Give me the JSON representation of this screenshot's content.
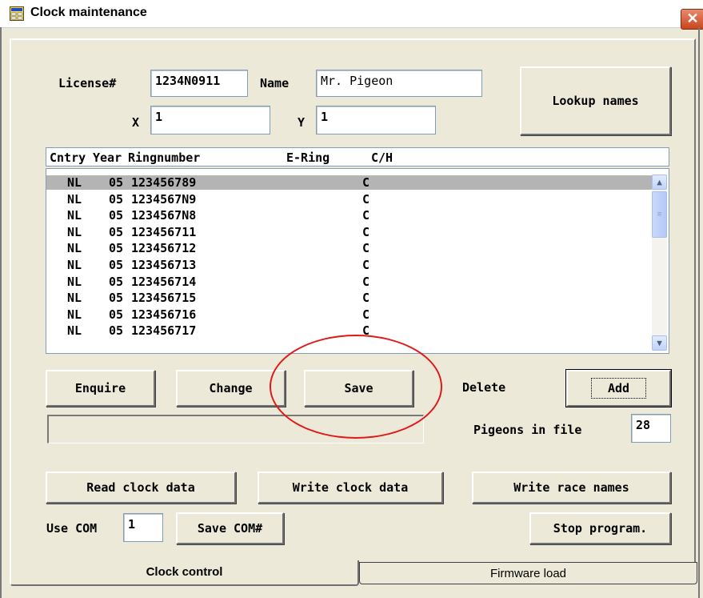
{
  "window": {
    "title": "Clock maintenance",
    "close_glyph": "✕"
  },
  "owner": {
    "license_label": "License#",
    "license_value": "1234N0911",
    "name_label": "Name",
    "name_value": "Mr. Pigeon",
    "x_label": "X",
    "x_value": "1",
    "y_label": "Y",
    "y_value": "1",
    "lookup_label": "Lookup names"
  },
  "list": {
    "columns": [
      "Cntry",
      "Year",
      "Ringnumber",
      "E-Ring",
      "C/H"
    ],
    "rows": [
      {
        "cntry": "NL",
        "year": "05",
        "ring": "123456789",
        "ering": "",
        "ch": "C"
      },
      {
        "cntry": "NL",
        "year": "05",
        "ring": "1234567N9",
        "ering": "",
        "ch": "C"
      },
      {
        "cntry": "NL",
        "year": "05",
        "ring": "1234567N8",
        "ering": "",
        "ch": "C"
      },
      {
        "cntry": "NL",
        "year": "05",
        "ring": "123456711",
        "ering": "",
        "ch": "C"
      },
      {
        "cntry": "NL",
        "year": "05",
        "ring": "123456712",
        "ering": "",
        "ch": "C"
      },
      {
        "cntry": "NL",
        "year": "05",
        "ring": "123456713",
        "ering": "",
        "ch": "C"
      },
      {
        "cntry": "NL",
        "year": "05",
        "ring": "123456714",
        "ering": "",
        "ch": "C"
      },
      {
        "cntry": "NL",
        "year": "05",
        "ring": "123456715",
        "ering": "",
        "ch": "C"
      },
      {
        "cntry": "NL",
        "year": "05",
        "ring": "123456716",
        "ering": "",
        "ch": "C"
      },
      {
        "cntry": "NL",
        "year": "05",
        "ring": "123456717",
        "ering": "",
        "ch": "C"
      }
    ],
    "selected_index": 0
  },
  "actions": {
    "enquire": "Enquire",
    "change": "Change",
    "save": "Save",
    "delete": "Delete",
    "add": "Add"
  },
  "status": {
    "message": "",
    "pigeons_label": "Pigeons in file",
    "pigeons_count": "28"
  },
  "clock": {
    "read": "Read clock data",
    "write": "Write clock data",
    "race_names": "Write race names",
    "com_label": "Use COM",
    "com_value": "1",
    "save_com": "Save COM#",
    "stop": "Stop program."
  },
  "tabs": [
    {
      "label": "Clock control",
      "active": true
    },
    {
      "label": "Firmware load",
      "active": false
    }
  ],
  "icons": {
    "app": "app-window-icon",
    "scroll_up": "▲",
    "scroll_down": "▼",
    "thumb_grip": "≡"
  },
  "colors": {
    "annotation": "#e01a1a",
    "selected_row": "#b4b4b4",
    "close_button": "#c8451d"
  }
}
